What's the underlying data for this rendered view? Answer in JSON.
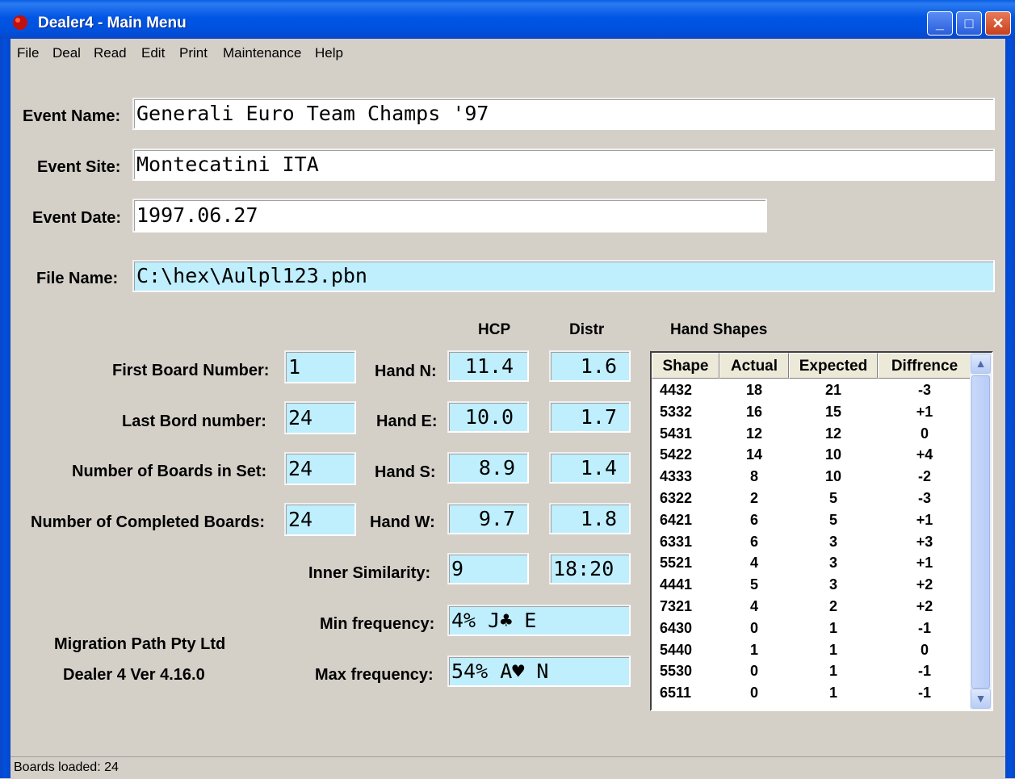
{
  "window": {
    "title": "Dealer4 - Main Menu"
  },
  "menu": [
    "File",
    "Deal",
    "Read",
    "Edit",
    "Print",
    "Maintenance",
    "Help"
  ],
  "event": {
    "name_label": "Event Name:",
    "name_value": "Generali Euro Team Champs '97",
    "site_label": "Event Site:",
    "site_value": "Montecatini ITA",
    "date_label": "Event Date:",
    "date_value": "1997.06.27",
    "file_label": "File Name:",
    "file_value": "C:\\hex\\Aulpl123.pbn"
  },
  "boards": {
    "first_label": "First Board Number:",
    "first_value": "1",
    "last_label": "Last Bord number:",
    "last_value": "24",
    "set_label": "Number of Boards in Set:",
    "set_value": "24",
    "completed_label": "Number of Completed Boards:",
    "completed_value": "24"
  },
  "hands": {
    "hcp_header": "HCP",
    "distr_header": "Distr",
    "rows": [
      {
        "label": "Hand N:",
        "hcp": "11.4",
        "distr": "1.6"
      },
      {
        "label": "Hand E:",
        "hcp": "10.0",
        "distr": "1.7"
      },
      {
        "label": "Hand S:",
        "hcp": "8.9",
        "distr": "1.4"
      },
      {
        "label": "Hand W:",
        "hcp": "9.7",
        "distr": "1.8"
      }
    ],
    "similarity_label": "Inner Similarity:",
    "similarity_value": "9",
    "similarity_ratio": "18:20",
    "min_label": "Min frequency:",
    "min_value": "4% J♣ E",
    "max_label": "Max frequency:",
    "max_value": "54% A♥ N"
  },
  "company": {
    "name": "Migration Path Pty Ltd",
    "version": "Dealer 4 Ver 4.16.0"
  },
  "shapes": {
    "title": "Hand Shapes",
    "columns": [
      "Shape",
      "Actual",
      "Expected",
      "Diffrence"
    ],
    "rows": [
      [
        "4432",
        "18",
        "21",
        "-3"
      ],
      [
        "5332",
        "16",
        "15",
        "+1"
      ],
      [
        "5431",
        "12",
        "12",
        "0"
      ],
      [
        "5422",
        "14",
        "10",
        "+4"
      ],
      [
        "4333",
        "8",
        "10",
        "-2"
      ],
      [
        "6322",
        "2",
        "5",
        "-3"
      ],
      [
        "6421",
        "6",
        "5",
        "+1"
      ],
      [
        "6331",
        "6",
        "3",
        "+3"
      ],
      [
        "5521",
        "4",
        "3",
        "+1"
      ],
      [
        "4441",
        "5",
        "3",
        "+2"
      ],
      [
        "7321",
        "4",
        "2",
        "+2"
      ],
      [
        "6430",
        "0",
        "1",
        "-1"
      ],
      [
        "5440",
        "1",
        "1",
        "0"
      ],
      [
        "5530",
        "0",
        "1",
        "-1"
      ],
      [
        "6511",
        "0",
        "1",
        "-1"
      ]
    ]
  },
  "status": "Boards loaded: 24"
}
